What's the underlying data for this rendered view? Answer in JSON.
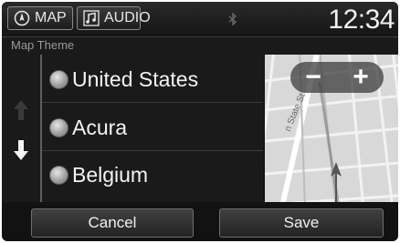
{
  "topbar": {
    "map_label": "MAP",
    "audio_label": "AUDIO",
    "clock": "12:34"
  },
  "subtitle": "Map Theme",
  "list": {
    "items": [
      {
        "label": "United States",
        "selected": false
      },
      {
        "label": "Acura",
        "selected": false
      },
      {
        "label": "Belgium",
        "selected": false
      }
    ]
  },
  "map": {
    "zoom_out_label": "−",
    "zoom_in_label": "+",
    "street_label": "n State St"
  },
  "footer": {
    "cancel_label": "Cancel",
    "save_label": "Save"
  },
  "colors": {
    "background": "#151515",
    "text": "#f4f4f4",
    "subtle_text": "#9a9a9a",
    "map_background": "#dcdcdc"
  },
  "icons": {
    "map": "compass-icon",
    "audio": "music-note-icon",
    "bluetooth": "bluetooth-icon",
    "scroll_up": "arrow-up-icon",
    "scroll_down": "arrow-down-icon",
    "vehicle": "vehicle-position-icon"
  }
}
